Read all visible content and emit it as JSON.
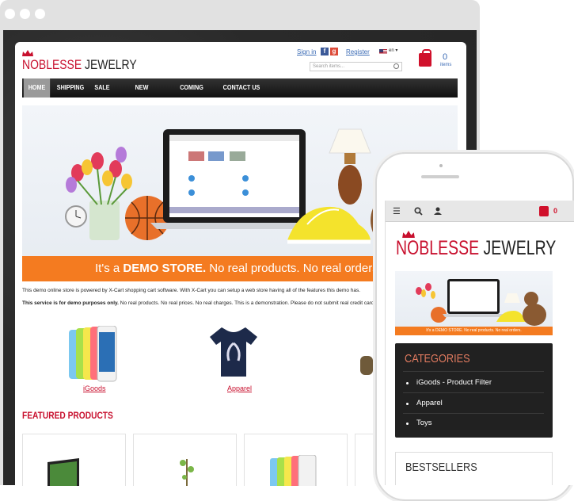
{
  "store": {
    "logo_first": "NOBLESSE",
    "logo_second": "JEWELRY",
    "sign_in": "Sign in",
    "register": "Register",
    "search_placeholder": "Search items...",
    "language": "en",
    "cart_count": "0",
    "cart_label": "items"
  },
  "nav": {
    "items": [
      {
        "label": "HOME",
        "active": true
      },
      {
        "label": "SHIPPING"
      },
      {
        "label": "SALE"
      },
      {
        "label": "NEW ARRIVALS"
      },
      {
        "label": "COMING SOON"
      },
      {
        "label": "CONTACT US"
      }
    ]
  },
  "hero": {
    "banner_prefix": "It's a ",
    "banner_strong": "DEMO STORE.",
    "banner_suffix": " No real products. No real orders."
  },
  "intro": {
    "line1": "This demo online store is powered by X-Cart shopping cart software. With X-Cart you can setup a web store having all of the features this demo has.",
    "line2_strong": "This service is for demo purposes only.",
    "line2_rest": " No real products. No real prices. No real charges. This is a demonstration. Please do not submit real credit card data."
  },
  "categories": [
    {
      "label": "iGoods"
    },
    {
      "label": "Apparel"
    }
  ],
  "featured": {
    "title": "FEATURED PRODUCTS"
  },
  "phone": {
    "logo_first": "NOBLESSE",
    "logo_second": "JEWELRY",
    "cart_count": "0",
    "banner_text": "It's a DEMO STORE. No real products. No real orders.",
    "categories_title": "CATEGORIES",
    "categories": [
      "iGoods - Product Filter",
      "Apparel",
      "Toys"
    ],
    "bestsellers_title": "BESTSELLERS"
  },
  "colors": {
    "accent_red": "#c8102e",
    "banner_orange": "#f47b20",
    "nav_dark": "#1f1f1f",
    "link_blue": "#3b6bb5"
  }
}
